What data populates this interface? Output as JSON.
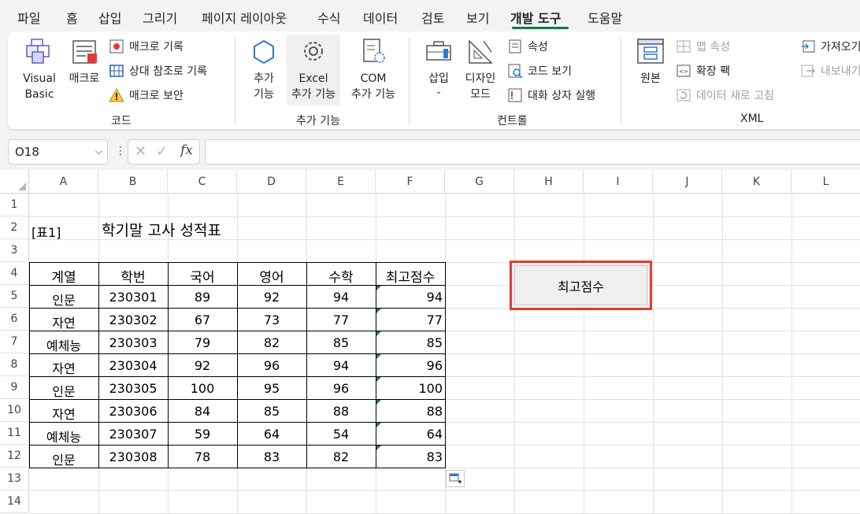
{
  "menu_tabs": [
    "파일",
    "홈",
    "삽입",
    "그리기",
    "페이지 레이아웃",
    "수식",
    "데이터",
    "검토",
    "보기",
    "개발 도구",
    "도움말"
  ],
  "active_tab": "개발 도구",
  "ribbon": {
    "code": {
      "visual_basic": [
        "Visual",
        "Basic"
      ],
      "macro": "매크로",
      "record_macro": "매크로 기록",
      "relative_ref": "상대 참조로 기록",
      "macro_security": "매크로 보안",
      "group": "코드"
    },
    "addins": {
      "addins": [
        "추가",
        "기능"
      ],
      "excel_addins": [
        "Excel",
        "추가 기능"
      ],
      "com_addins": [
        "COM",
        "추가 기능"
      ],
      "group": "추가 기능"
    },
    "controls": {
      "insert": "삽입",
      "design_mode": [
        "디자인",
        "모드"
      ],
      "properties": "속성",
      "view_code": "코드 보기",
      "run_dialog": "대화 상자 실행",
      "group": "컨트롤"
    },
    "xml": {
      "source": "원본",
      "map_properties": "맵 속성",
      "expansion_packs": "확장 팩",
      "refresh_data": "데이터 새로 고침",
      "import": "가져오기",
      "export": "내보내기",
      "group": "XML"
    }
  },
  "formula_bar": {
    "name_box": "O18",
    "fx": "fx",
    "formula": ""
  },
  "columns": [
    "A",
    "B",
    "C",
    "D",
    "E",
    "F",
    "G",
    "H",
    "I",
    "J",
    "K",
    "L"
  ],
  "rows": [
    "1",
    "2",
    "3",
    "4",
    "5",
    "6",
    "7",
    "8",
    "9",
    "10",
    "11",
    "12",
    "13",
    "14"
  ],
  "sheet": {
    "table_label": "[표1]",
    "title": "학기말 고사 성적표",
    "headers": [
      "계열",
      "학번",
      "국어",
      "영어",
      "수학",
      "최고점수"
    ],
    "records": [
      [
        "인문",
        "230301",
        "89",
        "92",
        "94",
        "94"
      ],
      [
        "자연",
        "230302",
        "67",
        "73",
        "77",
        "77"
      ],
      [
        "예체능",
        "230303",
        "79",
        "82",
        "85",
        "85"
      ],
      [
        "자연",
        "230304",
        "92",
        "96",
        "94",
        "96"
      ],
      [
        "인문",
        "230305",
        "100",
        "95",
        "96",
        "100"
      ],
      [
        "자연",
        "230306",
        "84",
        "85",
        "88",
        "88"
      ],
      [
        "예체능",
        "230307",
        "59",
        "64",
        "54",
        "64"
      ],
      [
        "인문",
        "230308",
        "78",
        "83",
        "82",
        "83"
      ]
    ],
    "macro_button": "최고점수"
  },
  "colors": {
    "accent": "#107c41",
    "highlight_border": "#e23a36",
    "error_triangle": "#1e7a3a"
  }
}
